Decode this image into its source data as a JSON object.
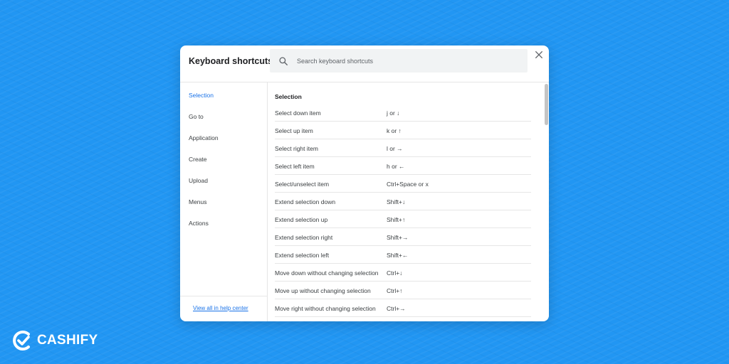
{
  "dialog": {
    "title": "Keyboard shortcuts",
    "search": {
      "placeholder": "Search keyboard shortcuts",
      "value": ""
    }
  },
  "sidebar": {
    "items": [
      {
        "label": "Selection",
        "active": true
      },
      {
        "label": "Go to"
      },
      {
        "label": "Application"
      },
      {
        "label": "Create"
      },
      {
        "label": "Upload"
      },
      {
        "label": "Menus"
      },
      {
        "label": "Actions"
      }
    ],
    "footer_link": "View all in help center"
  },
  "content": {
    "section_title": "Selection",
    "rows": [
      {
        "action": "Select down item",
        "keys": "j or ↓"
      },
      {
        "action": "Select up item",
        "keys": "k or ↑"
      },
      {
        "action": "Select right item",
        "keys": "l or →"
      },
      {
        "action": "Select left item",
        "keys": "h or ←"
      },
      {
        "action": "Select/unselect item",
        "keys": "Ctrl+Space or x"
      },
      {
        "action": "Extend selection down",
        "keys": "Shift+↓"
      },
      {
        "action": "Extend selection up",
        "keys": "Shift+↑"
      },
      {
        "action": "Extend selection right",
        "keys": "Shift+→"
      },
      {
        "action": "Extend selection left",
        "keys": "Shift+←"
      },
      {
        "action": "Move down without changing selection",
        "keys": "Ctrl+↓"
      },
      {
        "action": "Move up without changing selection",
        "keys": "Ctrl+↑"
      },
      {
        "action": "Move right without changing selection",
        "keys": "Ctrl+→"
      }
    ]
  },
  "brand": {
    "name": "CASHIFY"
  },
  "colors": {
    "background": "#2196f3",
    "accent": "#1a73e8"
  },
  "icons": {
    "search": "search-icon",
    "close": "close-icon",
    "logo": "cashify-logo-icon"
  }
}
